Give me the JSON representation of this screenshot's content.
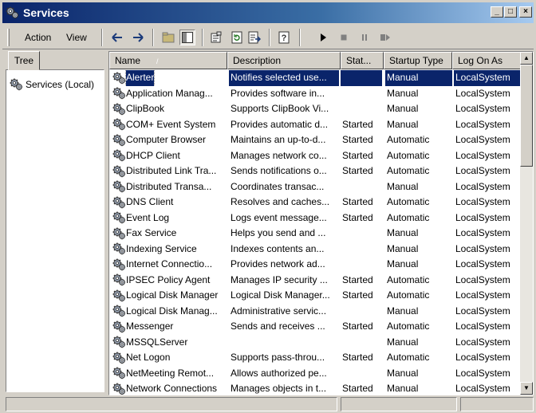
{
  "window": {
    "title": "Services"
  },
  "menu": {
    "action": "Action",
    "view": "View"
  },
  "tree": {
    "tab_label": "Tree",
    "root_label": "Services (Local)"
  },
  "list": {
    "columns": [
      "Name",
      "Description",
      "Stat...",
      "Startup Type",
      "Log On As"
    ],
    "sort_indicator": "/",
    "selected_index": 0,
    "rows": [
      {
        "name": "Alerter",
        "description": "Notifies selected use...",
        "status": "",
        "startup": "Manual",
        "logon": "LocalSystem"
      },
      {
        "name": "Application Manag...",
        "description": "Provides software in...",
        "status": "",
        "startup": "Manual",
        "logon": "LocalSystem"
      },
      {
        "name": "ClipBook",
        "description": "Supports ClipBook Vi...",
        "status": "",
        "startup": "Manual",
        "logon": "LocalSystem"
      },
      {
        "name": "COM+ Event System",
        "description": "Provides automatic d...",
        "status": "Started",
        "startup": "Manual",
        "logon": "LocalSystem"
      },
      {
        "name": "Computer Browser",
        "description": "Maintains an up-to-d...",
        "status": "Started",
        "startup": "Automatic",
        "logon": "LocalSystem"
      },
      {
        "name": "DHCP Client",
        "description": "Manages network co...",
        "status": "Started",
        "startup": "Automatic",
        "logon": "LocalSystem"
      },
      {
        "name": "Distributed Link Tra...",
        "description": "Sends notifications o...",
        "status": "Started",
        "startup": "Automatic",
        "logon": "LocalSystem"
      },
      {
        "name": "Distributed Transa...",
        "description": "Coordinates transac...",
        "status": "",
        "startup": "Manual",
        "logon": "LocalSystem"
      },
      {
        "name": "DNS Client",
        "description": "Resolves and caches...",
        "status": "Started",
        "startup": "Automatic",
        "logon": "LocalSystem"
      },
      {
        "name": "Event Log",
        "description": "Logs event message...",
        "status": "Started",
        "startup": "Automatic",
        "logon": "LocalSystem"
      },
      {
        "name": "Fax Service",
        "description": "Helps you send and ...",
        "status": "",
        "startup": "Manual",
        "logon": "LocalSystem"
      },
      {
        "name": "Indexing Service",
        "description": "Indexes contents an...",
        "status": "",
        "startup": "Manual",
        "logon": "LocalSystem"
      },
      {
        "name": "Internet Connectio...",
        "description": "Provides network ad...",
        "status": "",
        "startup": "Manual",
        "logon": "LocalSystem"
      },
      {
        "name": "IPSEC Policy Agent",
        "description": "Manages IP security ...",
        "status": "Started",
        "startup": "Automatic",
        "logon": "LocalSystem"
      },
      {
        "name": "Logical Disk Manager",
        "description": "Logical Disk Manager...",
        "status": "Started",
        "startup": "Automatic",
        "logon": "LocalSystem"
      },
      {
        "name": "Logical Disk Manag...",
        "description": "Administrative servic...",
        "status": "",
        "startup": "Manual",
        "logon": "LocalSystem"
      },
      {
        "name": "Messenger",
        "description": "Sends and receives ...",
        "status": "Started",
        "startup": "Automatic",
        "logon": "LocalSystem"
      },
      {
        "name": "MSSQLServer",
        "description": "",
        "status": "",
        "startup": "Manual",
        "logon": "LocalSystem"
      },
      {
        "name": "Net Logon",
        "description": "Supports pass-throu...",
        "status": "Started",
        "startup": "Automatic",
        "logon": "LocalSystem"
      },
      {
        "name": "NetMeeting Remot...",
        "description": "Allows authorized pe...",
        "status": "",
        "startup": "Manual",
        "logon": "LocalSystem"
      },
      {
        "name": "Network Connections",
        "description": "Manages objects in t...",
        "status": "Started",
        "startup": "Manual",
        "logon": "LocalSystem"
      }
    ]
  },
  "colors": {
    "titlebar_start": "#0a246a",
    "titlebar_end": "#a6caf0",
    "selection": "#0a246a",
    "chrome": "#d4d0c8"
  },
  "icons": [
    "services-gear-icon",
    "back-arrow-icon",
    "forward-arrow-icon",
    "up-folder-icon",
    "show-hide-tree-icon",
    "properties-icon",
    "refresh-icon",
    "export-list-icon",
    "help-icon",
    "play-icon",
    "stop-icon",
    "pause-icon",
    "restart-icon"
  ]
}
